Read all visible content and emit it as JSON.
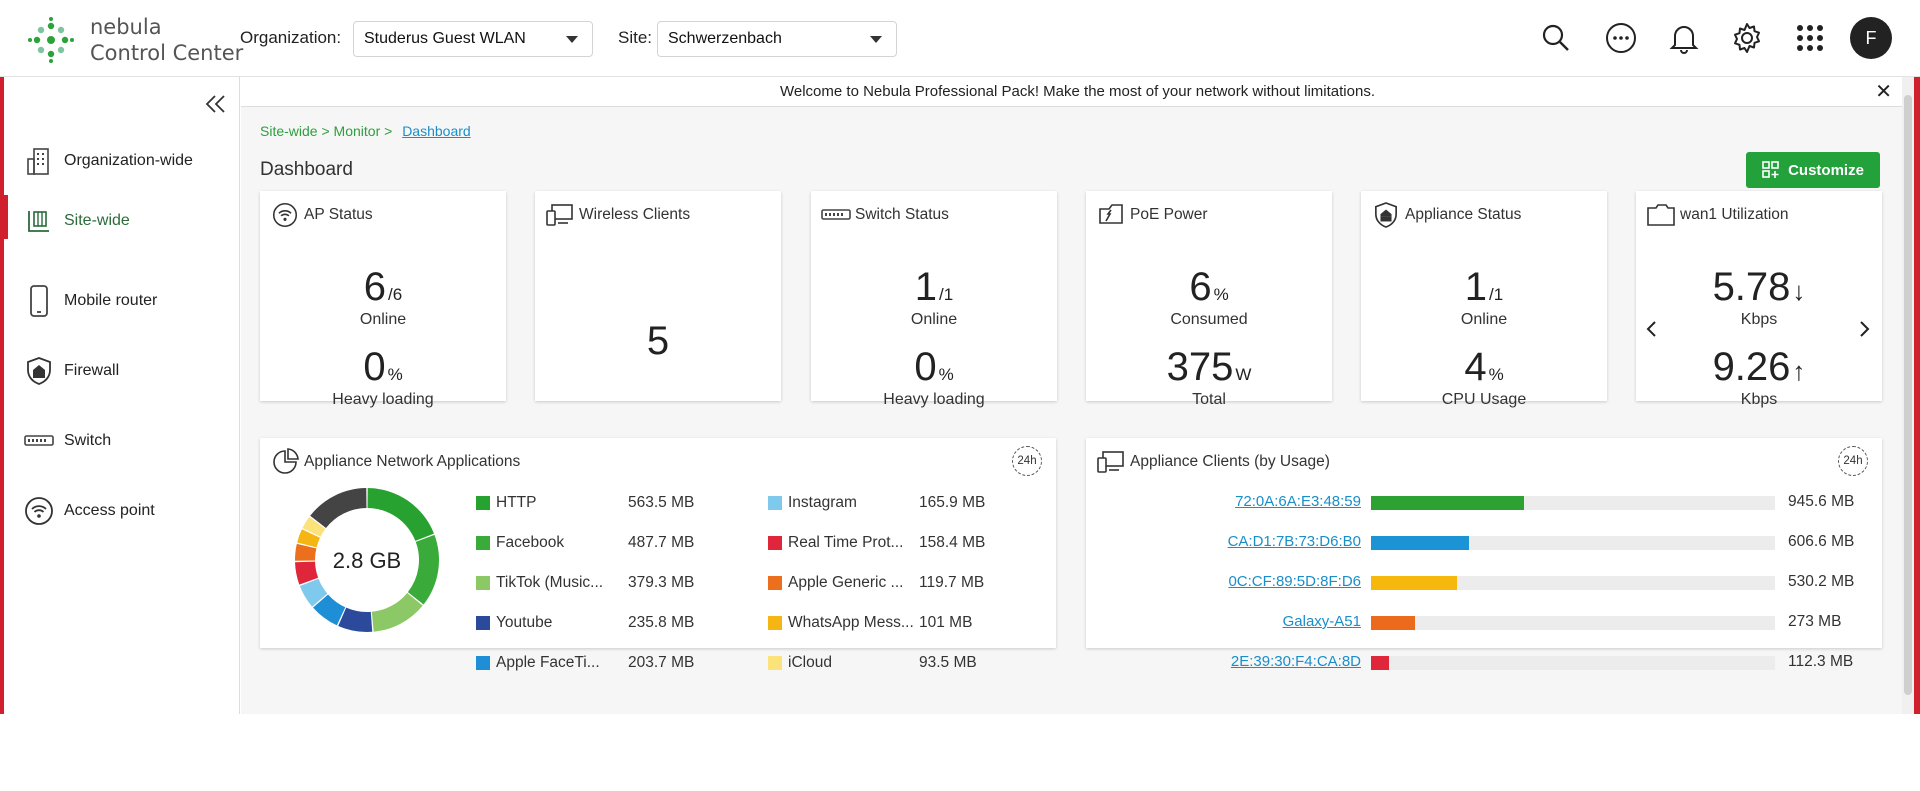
{
  "app": {
    "name_line1": "nebula",
    "name_line2": "Control Center"
  },
  "header": {
    "org_label": "Organization:",
    "org_value": "Studerus Guest WLAN",
    "site_label": "Site:",
    "site_value": "Schwerzenbach",
    "avatar_initial": "F",
    "icons": [
      "search-icon",
      "more-icon",
      "bell-icon",
      "gear-icon",
      "apps-grid-icon"
    ]
  },
  "sidebar": {
    "items": [
      {
        "label": "Organization-wide",
        "icon": "building-icon"
      },
      {
        "label": "Site-wide",
        "icon": "site-icon",
        "active": true
      },
      {
        "label": "Mobile router",
        "icon": "phone-icon"
      },
      {
        "label": "Firewall",
        "icon": "shield-icon"
      },
      {
        "label": "Switch",
        "icon": "switch-icon"
      },
      {
        "label": "Access point",
        "icon": "access-point-icon"
      }
    ]
  },
  "banner": {
    "text": "Welcome to Nebula Professional Pack! Make the most of your network without limitations."
  },
  "breadcrumb": {
    "part1": "Site-wide >",
    "part2": "Monitor >",
    "current": "Dashboard"
  },
  "page": {
    "title": "Dashboard",
    "customize_label": "Customize"
  },
  "cards": {
    "ap_status": {
      "title": "AP Status",
      "value": "6",
      "total": "/6",
      "label1": "Online",
      "load": "0",
      "load_unit": "%",
      "label2": "Heavy loading"
    },
    "wireless_clients": {
      "title": "Wireless Clients",
      "value": "5"
    },
    "switch_status": {
      "title": "Switch Status",
      "value": "1",
      "total": "/1",
      "label1": "Online",
      "load": "0",
      "load_unit": "%",
      "label2": "Heavy loading"
    },
    "poe_power": {
      "title": "PoE Power",
      "value": "6",
      "unit": "%",
      "label1": "Consumed",
      "total": "375",
      "total_unit": "W",
      "label2": "Total"
    },
    "appliance_status": {
      "title": "Appliance Status",
      "value": "1",
      "total": "/1",
      "label1": "Online",
      "cpu": "4",
      "cpu_unit": "%",
      "label2": "CPU Usage"
    },
    "wan1": {
      "title": "wan1 Utilization",
      "down": "5.78",
      "down_unit": "Kbps",
      "up": "9.26",
      "up_unit": "Kbps"
    }
  },
  "apps": {
    "title": "Appliance Network Applications",
    "period": "24h",
    "total": "2.8 GB",
    "items": [
      {
        "name": "HTTP",
        "value": "563.5 MB",
        "mb": 563.5,
        "color": "#27a12f"
      },
      {
        "name": "Facebook",
        "value": "487.7 MB",
        "mb": 487.7,
        "color": "#3aab3a"
      },
      {
        "name": "TikTok (Music...",
        "value": "379.3 MB",
        "mb": 379.3,
        "color": "#8cc865"
      },
      {
        "name": "Youtube",
        "value": "235.8 MB",
        "mb": 235.8,
        "color": "#2b4a9c"
      },
      {
        "name": "Apple FaceTi...",
        "value": "203.7 MB",
        "mb": 203.7,
        "color": "#1e8fd6"
      },
      {
        "name": "Instagram",
        "value": "165.9 MB",
        "mb": 165.9,
        "color": "#7fc9ec"
      },
      {
        "name": "Real Time Prot...",
        "value": "158.4 MB",
        "mb": 158.4,
        "color": "#e0263a"
      },
      {
        "name": "Apple Generic ...",
        "value": "119.7 MB",
        "mb": 119.7,
        "color": "#ec6f1e"
      },
      {
        "name": "WhatsApp Mess...",
        "value": "101 MB",
        "mb": 101,
        "color": "#f5b512"
      },
      {
        "name": "iCloud",
        "value": "93.5 MB",
        "mb": 93.5,
        "color": "#fbe27a"
      },
      {
        "name": "",
        "value": "",
        "mb": 430,
        "color": "#444444"
      }
    ]
  },
  "clients": {
    "title": "Appliance Clients (by Usage)",
    "period": "24h",
    "max_mb": 2500,
    "items": [
      {
        "name": "72:0A:6A:E3:48:59",
        "value": "945.6 MB",
        "mb": 945.6,
        "color": "#2da233"
      },
      {
        "name": "CA:D1:7B:73:D6:B0",
        "value": "606.6 MB",
        "mb": 606.6,
        "color": "#1b93d4"
      },
      {
        "name": "0C:CF:89:5D:8F:D6",
        "value": "530.2 MB",
        "mb": 530.2,
        "color": "#f6b80c"
      },
      {
        "name": "Galaxy-A51",
        "value": "273 MB",
        "mb": 273,
        "color": "#ec6a1c"
      },
      {
        "name": "2E:39:30:F4:CA:8D",
        "value": "112.3 MB",
        "mb": 112.3,
        "color": "#e0263a"
      }
    ]
  }
}
